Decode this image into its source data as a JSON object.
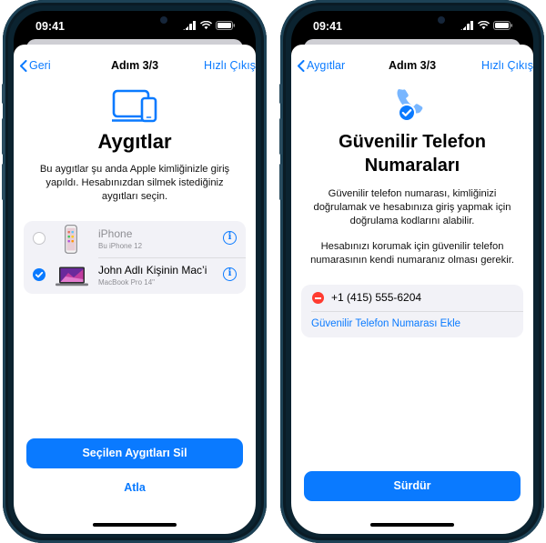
{
  "left": {
    "status": {
      "time": "09:41"
    },
    "nav": {
      "back": "Geri",
      "title": "Adım 3/3",
      "exit": "Hızlı Çıkış"
    },
    "heading": "Aygıtlar",
    "description": "Bu aygıtlar şu anda Apple kimliğinizle giriş yapıldı. Hesabınızdan silmek istediğiniz aygıtları seçin.",
    "devices": [
      {
        "name": "iPhone",
        "model": "Bu iPhone 12",
        "selected": false
      },
      {
        "name": "John Adlı Kişinin Mac’i",
        "model": "MacBook Pro 14\"",
        "selected": true
      }
    ],
    "primary_button": "Seçilen Aygıtları Sil",
    "secondary_button": "Atla"
  },
  "right": {
    "status": {
      "time": "09:41"
    },
    "nav": {
      "back": "Aygıtlar",
      "title": "Adım 3/3",
      "exit": "Hızlı Çıkış"
    },
    "heading_line1": "Güvenilir Telefon",
    "heading_line2": "Numaraları",
    "description1": "Güvenilir telefon numarası, kimliğinizi doğrulamak ve hesabınıza giriş yapmak için doğrulama kodlarını alabilir.",
    "description2": "Hesabınızı korumak için güvenilir telefon numarasının kendi numaranız olması gerekir.",
    "phone_number": "+1 (415) 555-6204",
    "add_link": "Güvenilir Telefon Numarası Ekle",
    "primary_button": "Sürdür"
  },
  "colors": {
    "accent": "#0a7aff",
    "destructive": "#ff3b30",
    "frame": "#0b2330"
  },
  "icons": [
    "devices-icon",
    "trusted-phone-icon",
    "checkmark-icon",
    "info-icon",
    "chevron-left-icon",
    "signal-icon",
    "wifi-icon",
    "battery-icon"
  ]
}
